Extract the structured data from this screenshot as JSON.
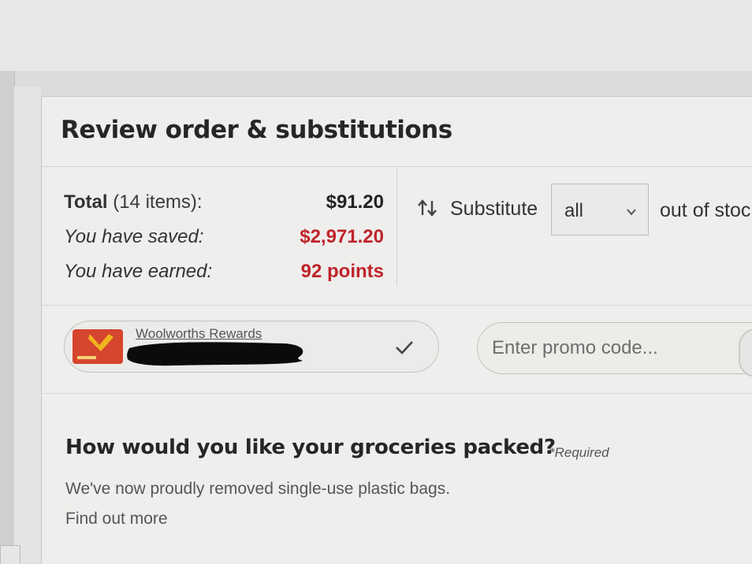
{
  "order": {
    "title": "Review order & substitutions",
    "total_label": "Total",
    "total_items": "(14 items):",
    "total_value": "$91.20",
    "saved_label": "You have saved:",
    "saved_value": "$2,971.20",
    "earned_label": "You have earned:",
    "earned_value": "92 points"
  },
  "substitution": {
    "icon": "substitute-icon",
    "label": "Substitute",
    "selected": "all",
    "suffix": "out of stoc"
  },
  "rewards": {
    "title": "Woolworths Rewards",
    "card_icon": "rewards-card-icon",
    "check_icon": "checkmark-icon"
  },
  "promo": {
    "placeholder": "Enter promo code..."
  },
  "packing": {
    "title": "How would you like your groceries packed?",
    "required": "*Required",
    "description": "We've now proudly removed single-use plastic bags.",
    "link": "Find out more"
  },
  "colors": {
    "accent_red": "#c0242b",
    "card_bg": "#eeeeec"
  }
}
